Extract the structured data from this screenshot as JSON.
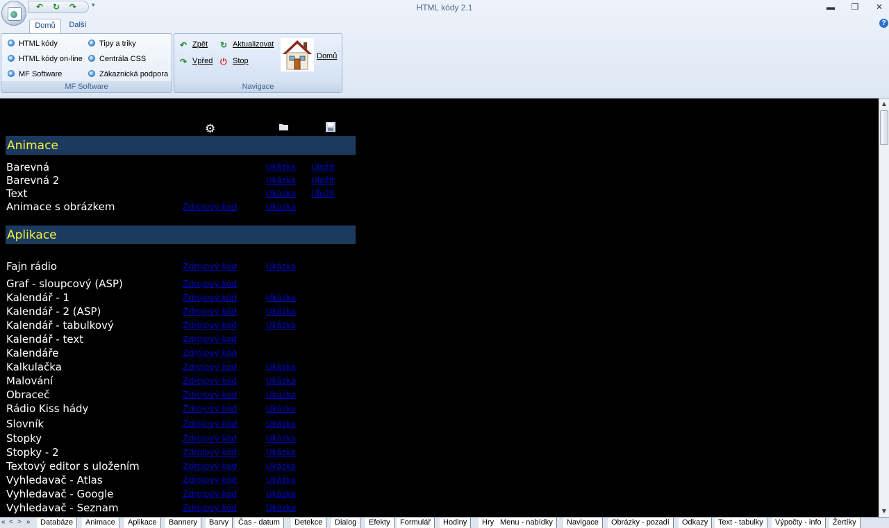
{
  "window": {
    "title": "HTML kódy 2.1",
    "minimize": "▬",
    "restore": "❐",
    "close": "✕",
    "help": "?"
  },
  "qat": {
    "back": "↶",
    "refresh": "↻",
    "forward": "↷",
    "customize": "▾"
  },
  "ribbon": {
    "tabs": [
      {
        "label": "Domů"
      },
      {
        "label": "Další"
      }
    ],
    "groups": {
      "mf": {
        "caption": "MF Software",
        "items": [
          {
            "label": "HTML kódy"
          },
          {
            "label": "HTML kódy on-line"
          },
          {
            "label": "MF Software"
          },
          {
            "label": "Tipy a triky"
          },
          {
            "label": "Centrála CSS"
          },
          {
            "label": "Zákaznická podpora"
          }
        ]
      },
      "nav": {
        "caption": "Navigace",
        "back": "Zpět",
        "forward": "Vpřed",
        "refresh": "Aktualizovat",
        "stop": "Stop",
        "home": "Domů"
      }
    }
  },
  "content": {
    "header_icons": [
      "gear-icon",
      "folder-icon",
      "disk-icon"
    ],
    "sections": [
      {
        "title": "Animace",
        "rows": [
          {
            "name": "Barevná",
            "source": "",
            "demo": "Ukázka",
            "save": "Uložit"
          },
          {
            "name": "Barevná 2",
            "source": "",
            "demo": "Ukázka",
            "save": "Uložit"
          },
          {
            "name": "Text",
            "source": "",
            "demo": "Ukázka",
            "save": "Uložit"
          },
          {
            "name": "Animace s obrázkem",
            "source": "Zdrojový kód",
            "demo": "Ukázka",
            "save": ""
          }
        ]
      },
      {
        "title": "Aplikace",
        "rows": [
          {
            "name": "Fajn rádio",
            "source": "Zdrojový kód",
            "demo": "Ukázka"
          },
          {
            "name": "Graf - sloupcový (ASP)",
            "source": "Zdrojový kód",
            "demo": ""
          },
          {
            "name": "Kalendář - 1",
            "source": "Zdrojový kód",
            "demo": "Ukázka"
          },
          {
            "name": "Kalendář - 2 (ASP)",
            "source": "Zdrojový kód",
            "demo": "Ukázka"
          },
          {
            "name": "Kalendář - tabulkový",
            "source": "Zdrojový kód",
            "demo": "Ukázka"
          },
          {
            "name": "Kalendář - text",
            "source": "Zdrojový kód",
            "demo": ""
          },
          {
            "name": "Kalendáře",
            "source": "Zdrojový kód",
            "demo": ""
          },
          {
            "name": "Kalkulačka",
            "source": "Zdrojový kód",
            "demo": "Ukázka"
          },
          {
            "name": "Malování",
            "source": "Zdrojový kód",
            "demo": "Ukázka"
          },
          {
            "name": "Obraceč",
            "source": "Zdrojový kód",
            "demo": "Ukázka"
          },
          {
            "name": "Rádio Kiss hády",
            "source": "Zdrojový kód",
            "demo": "Ukázka"
          },
          {
            "name": "Slovník",
            "source": "Zdrojový kód",
            "demo": "Ukázka"
          },
          {
            "name": "Stopky",
            "source": "Zdrojový kód",
            "demo": "Ukázka"
          },
          {
            "name": "Stopky - 2",
            "source": "Zdrojový kód",
            "demo": "Ukázka"
          },
          {
            "name": "Textový editor s uložením",
            "source": "Zdrojový kód",
            "demo": "Ukázka"
          },
          {
            "name": "Vyhledavač - Atlas",
            "source": "Zdrojový kód",
            "demo": "Ukázka"
          },
          {
            "name": "Vyhledavač - Google",
            "source": "Zdrojový kód",
            "demo": "Ukázka"
          },
          {
            "name": "Vyhledavač - Seznam",
            "source": "Zdrojový kód",
            "demo": "Ukázka"
          }
        ]
      }
    ]
  },
  "sheet_tabs": {
    "nav": [
      "«",
      "<",
      ">",
      "»"
    ],
    "tabs": [
      "Databáze",
      "Animace",
      "Aplikace",
      "Bannery",
      "Barvy",
      "Čas - datum",
      "Detekce",
      "Dialog",
      "Efekty",
      "Formulář",
      "Hodiny",
      "Hry",
      "Menu - nabídky",
      "Navigace",
      "Obrázky - pozadí",
      "Odkazy",
      "Text - tabulky",
      "Výpočty - info",
      "Žertíky"
    ]
  },
  "colors": {
    "section_bar": "#1b3a5e",
    "section_title": "#f6f23a",
    "link": "#0000c8",
    "background": "#000000"
  }
}
